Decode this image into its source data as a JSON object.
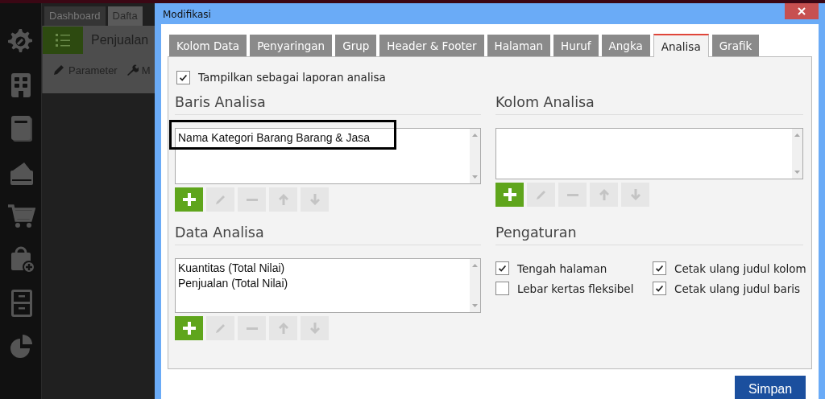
{
  "app": {
    "sidebar": [
      {
        "kind": "gear"
      },
      {
        "kind": "building"
      },
      {
        "kind": "book"
      },
      {
        "kind": "wallet"
      },
      {
        "kind": "cart"
      },
      {
        "kind": "bag"
      },
      {
        "kind": "cabinet"
      },
      {
        "kind": "pie"
      }
    ],
    "tabs": [
      {
        "label": "Dashboard",
        "selected": false
      },
      {
        "label": "Dafta",
        "selected": true
      }
    ],
    "report_title": "Penjualan",
    "toolbar": [
      {
        "kind": "pencil",
        "label": "Parameter"
      },
      {
        "kind": "wrench",
        "label": "M"
      }
    ]
  },
  "dialog": {
    "title": "Modifikasi",
    "tabs": [
      {
        "label": "Kolom Data",
        "selected": false
      },
      {
        "label": "Penyaringan",
        "selected": false
      },
      {
        "label": "Grup",
        "selected": false
      },
      {
        "label": "Header & Footer",
        "selected": false
      },
      {
        "label": "Halaman",
        "selected": false
      },
      {
        "label": "Huruf",
        "selected": false
      },
      {
        "label": "Angka",
        "selected": false
      },
      {
        "label": "Analisa",
        "selected": true
      },
      {
        "label": "Grafik",
        "selected": false
      }
    ],
    "show_as_analysis": {
      "label": "Tampilkan sebagai laporan analisa",
      "checked": true
    },
    "sections": [
      {
        "kind": "list",
        "title": "Baris Analisa",
        "items": [
          {
            "text": "Nama Kategori Barang Barang & Jasa",
            "highlighted": true
          }
        ],
        "buttons": [
          {
            "kind": "add",
            "disabled": false
          },
          {
            "kind": "edit",
            "disabled": true
          },
          {
            "kind": "remove",
            "disabled": true
          },
          {
            "kind": "up",
            "disabled": true
          },
          {
            "kind": "down",
            "disabled": true
          }
        ]
      },
      {
        "kind": "list",
        "title": "Kolom Analisa",
        "buttons": [
          {
            "kind": "add",
            "disabled": false
          },
          {
            "kind": "edit",
            "disabled": true
          },
          {
            "kind": "remove",
            "disabled": true
          },
          {
            "kind": "up",
            "disabled": true
          },
          {
            "kind": "down",
            "disabled": true
          }
        ]
      },
      {
        "kind": "list",
        "title": "Data Analisa",
        "items": [
          {
            "text": "Kuantitas (Total Nilai)",
            "highlighted": false
          },
          {
            "text": "Penjualan (Total Nilai)",
            "highlighted": false
          }
        ],
        "buttons": [
          {
            "kind": "add",
            "disabled": false
          },
          {
            "kind": "edit",
            "disabled": true
          },
          {
            "kind": "remove",
            "disabled": true
          },
          {
            "kind": "up",
            "disabled": true
          },
          {
            "kind": "down",
            "disabled": true
          }
        ]
      },
      {
        "kind": "settings",
        "title": "Pengaturan",
        "options": [
          {
            "label": "Tengah halaman",
            "checked": true
          },
          {
            "label": "Cetak ulang judul kolom",
            "checked": true
          },
          {
            "label": "Lebar kertas fleksibel",
            "checked": false
          },
          {
            "label": "Cetak ulang judul baris",
            "checked": true
          }
        ]
      }
    ],
    "save_button": "Simpan"
  }
}
